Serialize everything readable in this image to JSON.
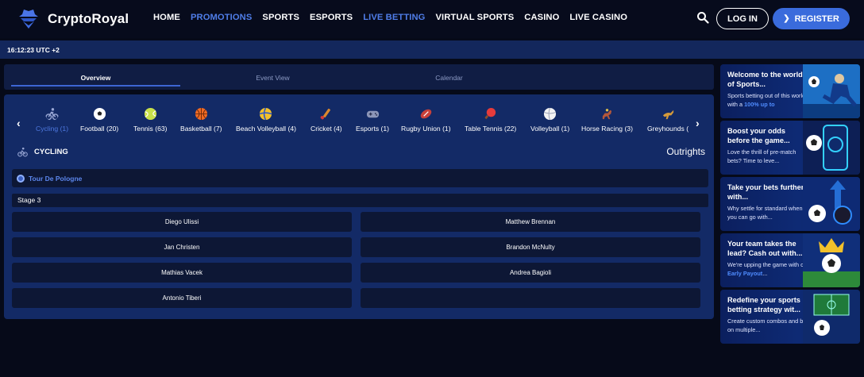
{
  "brand": {
    "name": "CryptoRoyal"
  },
  "nav": {
    "items": [
      {
        "label": "HOME",
        "accent": false
      },
      {
        "label": "PROMOTIONS",
        "accent": true
      },
      {
        "label": "SPORTS",
        "accent": false
      },
      {
        "label": "ESPORTS",
        "accent": false
      },
      {
        "label": "LIVE BETTING",
        "accent": true
      },
      {
        "label": "VIRTUAL SPORTS",
        "accent": false
      },
      {
        "label": "CASINO",
        "accent": false
      },
      {
        "label": "LIVE CASINO",
        "accent": false
      }
    ],
    "login_label": "LOG IN",
    "register_label": "REGISTER"
  },
  "status": {
    "time": "16:12:23 UTC +2"
  },
  "tabs": [
    {
      "label": "Overview",
      "active": true
    },
    {
      "label": "Event View",
      "active": false
    },
    {
      "label": "Calendar",
      "active": false
    }
  ],
  "sports": [
    {
      "label": "Cycling (1)",
      "icon": "cycling-icon",
      "active": true,
      "color": "#9aa8d6"
    },
    {
      "label": "Football (20)",
      "icon": "football-icon",
      "active": false,
      "color": "#ffffff"
    },
    {
      "label": "Tennis (63)",
      "icon": "tennis-icon",
      "active": false,
      "color": "#c8e04a"
    },
    {
      "label": "Basketball (7)",
      "icon": "basketball-icon",
      "active": false,
      "color": "#f06a23"
    },
    {
      "label": "Beach Volleyball (4)",
      "icon": "beach-volleyball-icon",
      "active": false,
      "color": "#f2c02a"
    },
    {
      "label": "Cricket (4)",
      "icon": "cricket-icon",
      "active": false,
      "color": "#d9892d"
    },
    {
      "label": "Esports (1)",
      "icon": "gamepad-icon",
      "active": false,
      "color": "#8d96b8"
    },
    {
      "label": "Rugby Union (1)",
      "icon": "rugby-icon",
      "active": false,
      "color": "#c9403a"
    },
    {
      "label": "Table Tennis (22)",
      "icon": "table-tennis-icon",
      "active": false,
      "color": "#e63b3b"
    },
    {
      "label": "Volleyball (1)",
      "icon": "volleyball-icon",
      "active": false,
      "color": "#f2f2f2"
    },
    {
      "label": "Horse Racing (3)",
      "icon": "horse-racing-icon",
      "active": false,
      "color": "#b3573a"
    },
    {
      "label": "Greyhounds (",
      "icon": "greyhound-icon",
      "active": false,
      "color": "#d49a3a"
    }
  ],
  "section": {
    "title": "CYCLING",
    "outrights_label": "Outrights"
  },
  "event": {
    "league": "Tour De Pologne",
    "stage": "Stage 3",
    "runners": [
      [
        "Diego Ulissi",
        "Matthew Brennan"
      ],
      [
        "Jan Christen",
        "Brandon McNulty"
      ],
      [
        "Mathias Vacek",
        "Andrea Bagioli"
      ],
      [
        "Antonio Tiberi",
        ""
      ]
    ]
  },
  "promos": [
    {
      "title": "Welcome to the world of Sports...",
      "body_pre": "Sports betting out of this world with a ",
      "body_hl": "100% up to",
      "body_post": ""
    },
    {
      "title": "Boost your odds before the game...",
      "body_pre": "Love the thrill of pre-match bets? Time to leve...",
      "body_hl": "",
      "body_post": ""
    },
    {
      "title": "Take your bets further with...",
      "body_pre": "Why settle for standard when you can go with...",
      "body_hl": "",
      "body_post": ""
    },
    {
      "title": "Your team takes the lead? Cash out with...",
      "body_pre": "We're upping the game with our ",
      "body_hl": "Early Payout",
      "body_post": "..."
    },
    {
      "title": "Redefine your sports betting strategy wit...",
      "body_pre": "Create custom combos and bet on multiple...",
      "body_hl": "",
      "body_post": ""
    }
  ],
  "colors": {
    "accent": "#3a6bdc",
    "panel": "#132a66",
    "row": "#0d1735",
    "link": "#4f7de8"
  }
}
